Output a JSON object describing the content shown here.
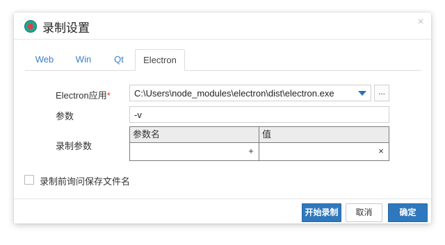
{
  "dialog": {
    "title": "录制设置",
    "close_symbol": "×",
    "icon": "record-app-icon"
  },
  "tabs": [
    {
      "label": "Web",
      "active": false
    },
    {
      "label": "Win",
      "active": false
    },
    {
      "label": "Qt",
      "active": false
    },
    {
      "label": "Electron",
      "active": true
    }
  ],
  "form": {
    "app_label": "Electron应用",
    "required_mark": "*",
    "app_path": "C:\\Users\\node_modules\\electron\\dist\\electron.exe",
    "browse_label": "...",
    "args_label": "参数",
    "args_value": "-v",
    "record_params_label": "录制参数"
  },
  "params_table": {
    "columns": [
      "参数名",
      "值"
    ],
    "rows": [
      {
        "name": "",
        "value": ""
      }
    ],
    "add_symbol": "+",
    "remove_symbol": "×"
  },
  "checkbox": {
    "label": "录制前询问保存文件名",
    "checked": false
  },
  "buttons": {
    "start": "开始录制",
    "cancel": "取消",
    "ok": "确定"
  },
  "colors": {
    "accent": "#2f78bd",
    "link": "#3a7ec3",
    "required": "#d9302f",
    "app_icon_teal": "#1fa594",
    "app_icon_red": "#e53c3c"
  }
}
